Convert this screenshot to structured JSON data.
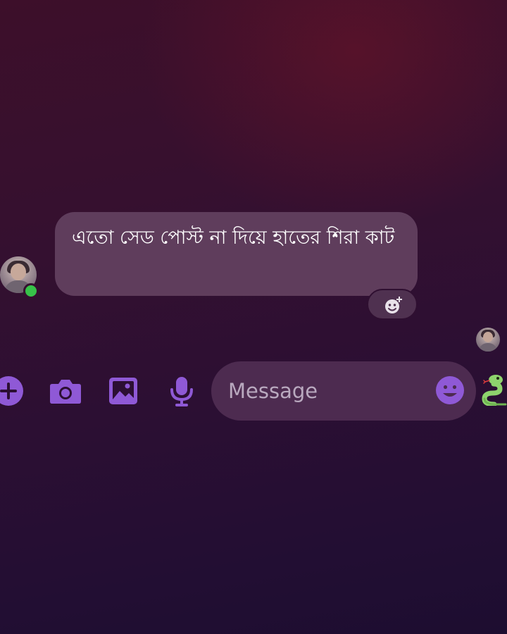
{
  "conversation": {
    "incoming_message": {
      "text": "এতো সেড পোস্ট না দিয়ে হাতের শিরা কাট"
    }
  },
  "icons": {
    "avatar": "contact-avatar",
    "online": "online-status-dot",
    "reaction": "add-reaction-icon",
    "seen": "seen-receipt-avatar",
    "plus": "plus-icon",
    "camera": "camera-icon",
    "gallery": "gallery-icon",
    "mic": "microphone-icon",
    "emoji": "emoji-icon",
    "quick_reaction": "snake-icon"
  },
  "composer": {
    "placeholder": "Message"
  },
  "colors": {
    "accent": "#8f59d6",
    "bubble": "#5f3d5c",
    "online": "#37c249",
    "snake": "#8ed36d"
  }
}
